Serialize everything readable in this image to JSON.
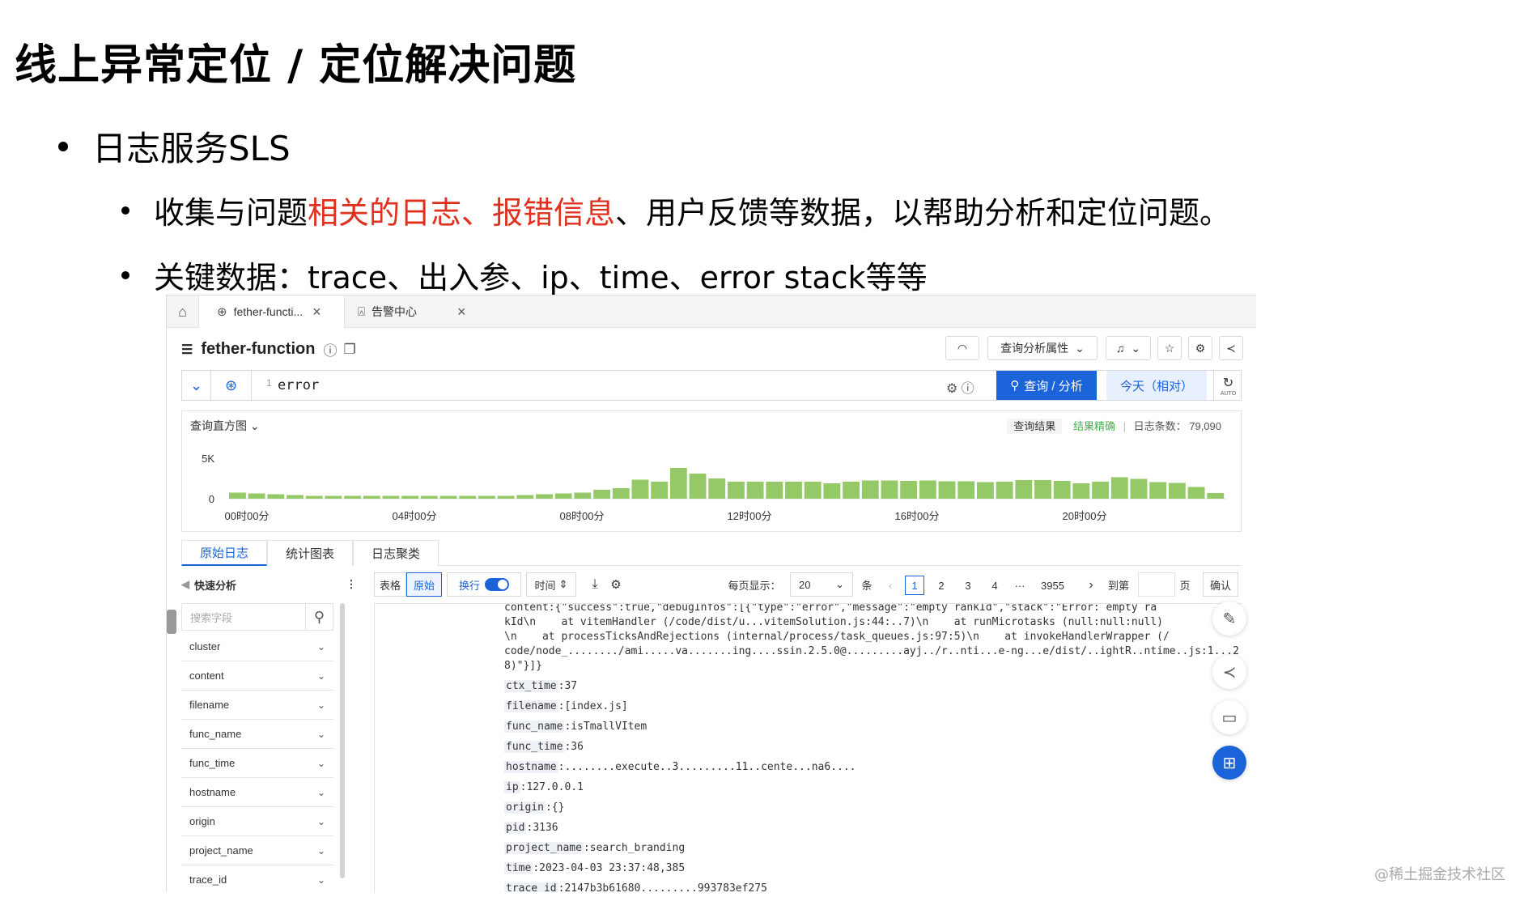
{
  "slide": {
    "title": "线上异常定位 / 定位解决问题",
    "bullet1": "日志服务SLS",
    "bullet2_pre": "收集与问题",
    "bullet2_red": "相关的日志、报错信息",
    "bullet2_post": "、用户反馈等数据，以帮助分析和定位问题。",
    "bullet3": "关键数据：trace、出入参、ip、time、error stack等等"
  },
  "app": {
    "tabs": [
      {
        "label": "fether-functi...",
        "icon": "query-icon"
      },
      {
        "label": "告警中心",
        "icon": "alarm-icon"
      }
    ],
    "resource_name": "fether-function",
    "toolbar": {
      "analysis_attr": "查询分析属性"
    },
    "query": {
      "line_no": "1",
      "text": "error",
      "submit": "查询 / 分析",
      "time_range": "今天（相对）",
      "refresh_mode": "AUTO"
    },
    "histogram": {
      "title": "查询直方图",
      "result_label": "查询结果",
      "precision": "结果精确",
      "count_label": "日志条数：",
      "count": "79,090"
    },
    "subtabs": [
      "原始日志",
      "统计图表",
      "日志聚类"
    ],
    "controls": {
      "quick_analysis": "快速分析",
      "view_table": "表格",
      "view_raw": "原始",
      "wrap": "换行",
      "time_sort": "时间",
      "per_page_label": "每页显示：",
      "per_page": "20",
      "unit": "条",
      "pages": [
        "1",
        "2",
        "3",
        "4",
        "···",
        "3955"
      ],
      "goto_label": "到第",
      "page_unit": "页",
      "confirm": "确认"
    },
    "sidebar": {
      "search_placeholder": "搜索字段",
      "fields": [
        "cluster",
        "content",
        "filename",
        "func_name",
        "func_time",
        "hostname",
        "origin",
        "project_name",
        "trace_id"
      ]
    },
    "log": {
      "stack_lines": [
        "content:{\"success\":true,\"debugInfos\":[{\"type\":\"error\",\"message\":\"empty rankId\",\"stack\":\"Error: empty ra",
        "kId\\n    at vitemHandler (/code/dist/u...vitemSolution.js:44:..7)\\n    at runMicrotasks (null:null:null)",
        "\\n    at processTicksAndRejections (internal/process/task_queues.js:97:5)\\n    at invokeHandlerWrapper (/",
        "code/node_......../ami.....va.......ing....ssin.2.5.0@.........ayj../r..nti...e-ng...e/dist/..ightR..ntime..js:1...2",
        "8)\"}]}"
      ],
      "fields": [
        {
          "key": "ctx_time",
          "value": "37"
        },
        {
          "key": "filename",
          "value": "[index.js]"
        },
        {
          "key": "func_name",
          "value": "isTmallVItem"
        },
        {
          "key": "func_time",
          "value": "36"
        },
        {
          "key": "hostname",
          "value": "........execute..3.........11..cente...na6...."
        },
        {
          "key": "ip",
          "value": "127.0.0.1"
        },
        {
          "key": "origin",
          "value": "{}"
        },
        {
          "key": "pid",
          "value": "3136"
        },
        {
          "key": "project_name",
          "value": "search_branding"
        },
        {
          "key": "time",
          "value": "2023-04-03 23:37:48,385"
        },
        {
          "key": "trace_id",
          "value": "2147b3b61680.........993783ef275"
        }
      ]
    }
  },
  "chart_data": {
    "type": "bar",
    "title": "",
    "xlabel": "",
    "ylabel": "",
    "ylim": [
      0,
      5000
    ],
    "y_ticks": [
      "5K",
      "0"
    ],
    "x_ticks": [
      "00时00分",
      "04时00分",
      "08时00分",
      "12时00分",
      "16时00分",
      "20时00分"
    ],
    "values": [
      750,
      650,
      550,
      450,
      350,
      350,
      350,
      350,
      350,
      350,
      350,
      350,
      350,
      350,
      350,
      450,
      550,
      650,
      750,
      1100,
      1300,
      2350,
      2100,
      3800,
      3100,
      2500,
      2100,
      2100,
      2100,
      2100,
      2100,
      1900,
      2100,
      2250,
      2250,
      2200,
      2250,
      2150,
      2150,
      2050,
      2100,
      2300,
      2300,
      2200,
      1900,
      2100,
      2650,
      2450,
      2050,
      1950,
      1450,
      700
    ],
    "bar_color": "#95c866"
  },
  "colors": {
    "accent": "#1a63d8",
    "highlight_red": "#e0301e",
    "success_green": "#4caf50"
  }
}
